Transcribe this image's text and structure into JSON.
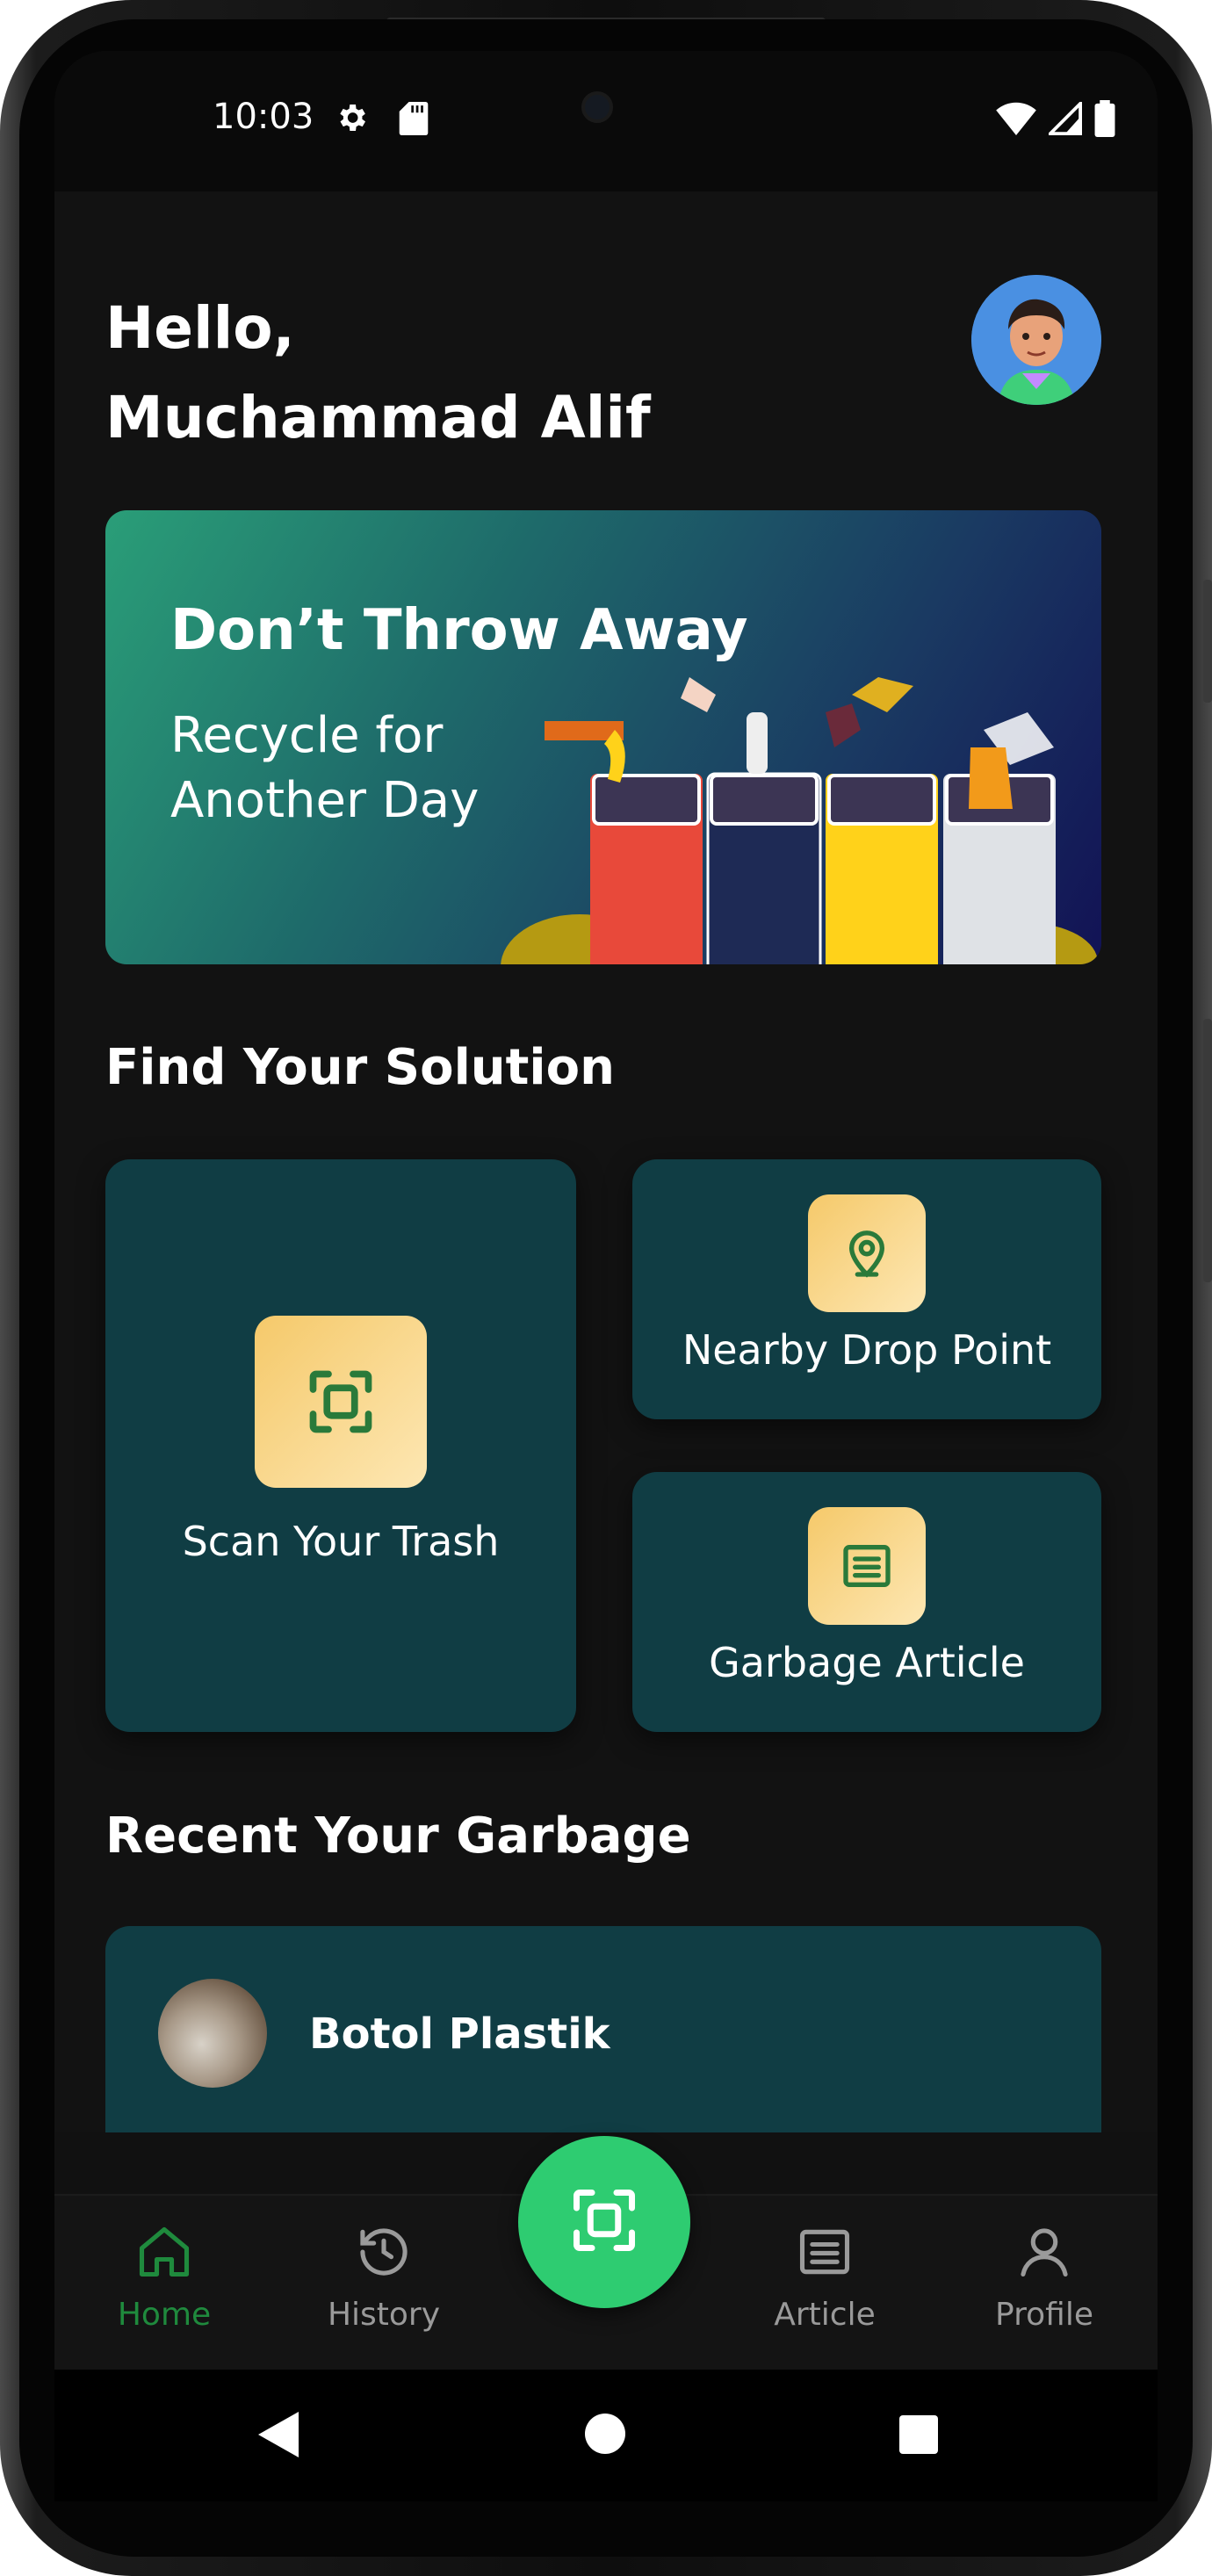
{
  "status_bar": {
    "time": "10:03",
    "icons": [
      "gear-icon",
      "sd-card-icon",
      "wifi-icon",
      "signal-icon",
      "battery-icon"
    ]
  },
  "header": {
    "greeting_line1": "Hello,",
    "greeting_line2": "Muchammad Alif"
  },
  "banner": {
    "title": "Don’t Throw Away",
    "subtitle_line1": "Recycle for",
    "subtitle_line2": "Another Day"
  },
  "solutions": {
    "title": "Find Your Solution",
    "scan": {
      "label": "Scan Your Trash",
      "icon": "scan-icon"
    },
    "nearby": {
      "label": "Nearby Drop Point",
      "icon": "location-pin-icon"
    },
    "article": {
      "label": "Garbage Article",
      "icon": "article-icon"
    }
  },
  "recent": {
    "title": "Recent Your Garbage",
    "items": [
      {
        "name": "Botol Plastik"
      }
    ]
  },
  "bottom_nav": {
    "items": [
      {
        "label": "Home",
        "icon": "home-icon",
        "active": true
      },
      {
        "label": "History",
        "icon": "history-icon",
        "active": false
      },
      {
        "label": "Article",
        "icon": "article-icon",
        "active": false
      },
      {
        "label": "Profile",
        "icon": "profile-icon",
        "active": false
      }
    ],
    "fab_icon": "scan-icon"
  },
  "colors": {
    "accent": "#2ecc71",
    "card": "#103d44",
    "icon_bg": "#f5c96a",
    "active_nav": "#1f8a3d",
    "background": "#121212"
  }
}
